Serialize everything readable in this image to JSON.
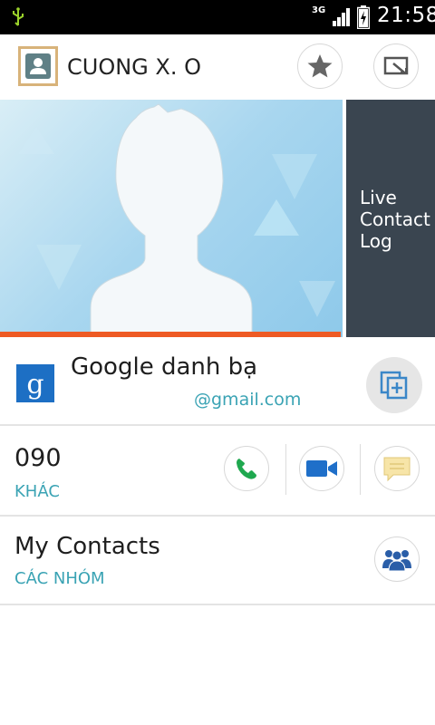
{
  "status_bar": {
    "network": "3G",
    "time": "21:58",
    "icons": [
      "usb-icon",
      "signal-icon",
      "battery-charging-icon"
    ]
  },
  "header": {
    "contact_name": "CUONG X. O",
    "icons": [
      "contact-avatar-icon",
      "star-icon",
      "edit-contact-icon"
    ]
  },
  "gallery": {
    "live_log_label": "Live Contact Log"
  },
  "account": {
    "title": "Google danh bạ",
    "email": "@gmail.com",
    "icons": [
      "google-logo",
      "copy-to-account-icon"
    ]
  },
  "phone": {
    "number": "090",
    "type": "KHÁC",
    "icons": [
      "phone-icon",
      "video-call-icon",
      "message-icon"
    ]
  },
  "groups": {
    "title": "My Contacts",
    "subtitle": "CÁC NHÓM",
    "icons": [
      "groups-icon"
    ]
  },
  "colors": {
    "accent_teal": "#3aa3b4",
    "progress_orange": "#ee5a24",
    "phone_green": "#1fa84f",
    "video_blue": "#1f6fc9",
    "groups_blue": "#2a5ea8"
  }
}
